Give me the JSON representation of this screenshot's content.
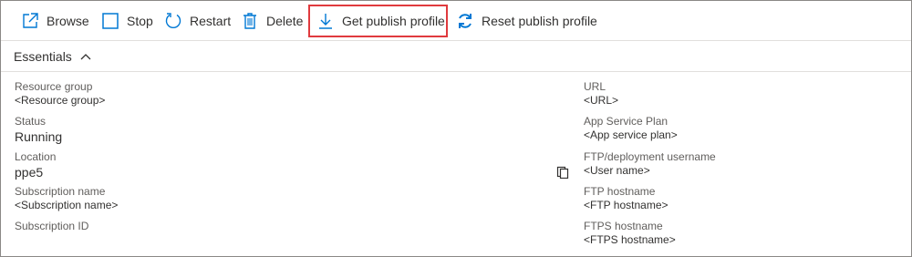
{
  "toolbar": {
    "browse_label": "Browse",
    "stop_label": "Stop",
    "restart_label": "Restart",
    "delete_label": "Delete",
    "get_publish_profile_label": "Get publish profile",
    "reset_publish_profile_label": "Reset publish profile",
    "accent_color": "#0078d4",
    "highlight_color": "#e03a3e"
  },
  "essentials": {
    "title": "Essentials",
    "state": "expanded"
  },
  "left_fields": [
    {
      "label": "Resource group",
      "value": "<Resource group>"
    },
    {
      "label": "Status",
      "value": "Running"
    },
    {
      "label": "Location",
      "value": "ppe5"
    },
    {
      "label": "Subscription name",
      "value": "<Subscription name>"
    },
    {
      "label": "Subscription ID",
      "value": ""
    }
  ],
  "right_fields": [
    {
      "label": "URL",
      "value": "<URL>"
    },
    {
      "label": "App Service Plan",
      "value": "<App service plan>"
    },
    {
      "label": "FTP/deployment username",
      "value": "<User name>"
    },
    {
      "label": "FTP hostname",
      "value": "<FTP hostname>"
    },
    {
      "label": "FTPS hostname",
      "value": "<FTPS hostname>"
    }
  ]
}
